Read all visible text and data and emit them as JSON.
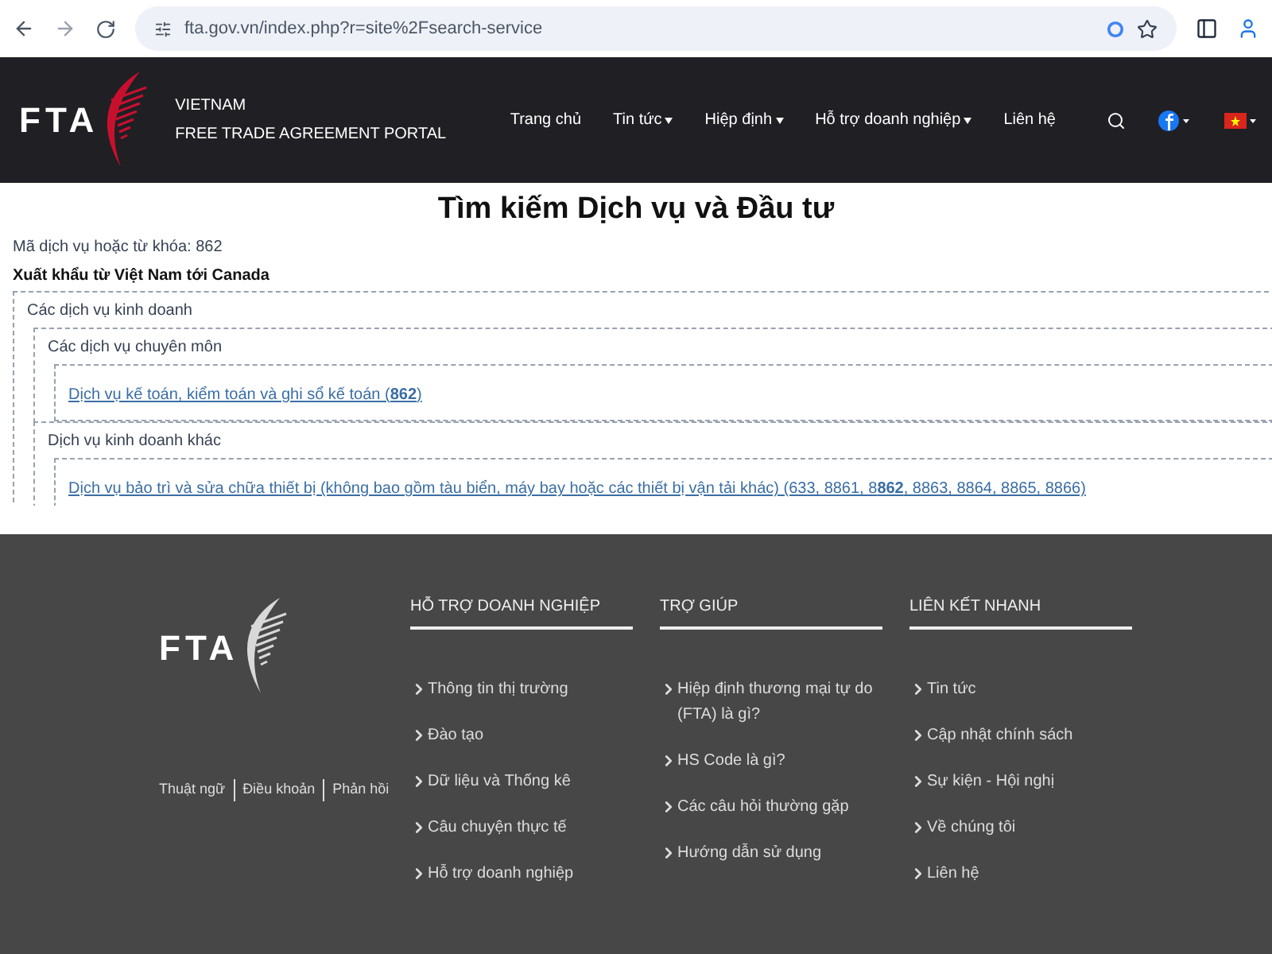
{
  "browser": {
    "url": "fta.gov.vn/index.php?r=site%2Fsearch-service"
  },
  "header": {
    "logo": "FTA",
    "site_line_1": "VIETNAM",
    "site_line_2": "FREE TRADE AGREEMENT PORTAL",
    "nav": [
      {
        "label": "Trang chủ",
        "dropdown": false
      },
      {
        "label": "Tin tức",
        "dropdown": true
      },
      {
        "label": "Hiệp định",
        "dropdown": true
      },
      {
        "label": "Hỗ trợ doanh nghiệp",
        "dropdown": true
      },
      {
        "label": "Liên hệ",
        "dropdown": false
      }
    ]
  },
  "page": {
    "title": "Tìm kiếm Dịch vụ và Đầu tư",
    "query": "Mã dịch vụ hoặc từ khóa: 862",
    "direction": "Xuất khẩu từ Việt Nam tới Canada",
    "tree": [
      {
        "title": "Các dịch vụ kinh doanh",
        "children": [
          {
            "title": "Các dịch vụ chuyên môn",
            "links": [
              "Dịch vụ kế toán, kiểm toán và ghi sổ kế toán (**862**)"
            ]
          },
          {
            "title": "Dịch vụ kinh doanh khác",
            "links": [
              "Dịch vụ bảo trì và sửa chữa thiết bị (không bao gồm tàu biển, máy bay hoặc các thiết bị vận tải khác) (633, 8861, 8**862**, 8863, 8864, 8865, 8866)"
            ]
          }
        ]
      }
    ]
  },
  "footer": {
    "logo": "FTA",
    "bottom_links": [
      "Thuật ngữ",
      "Điều khoản",
      "Phản hồi"
    ],
    "columns": [
      {
        "heading": "HỖ TRỢ DOANH NGHIỆP",
        "links": [
          "Thông tin thị trường",
          "Đào tạo",
          "Dữ liệu và Thống kê",
          "Câu chuyện thực tế",
          "Hỗ trợ doanh nghiệp"
        ]
      },
      {
        "heading": "TRỢ GIÚP",
        "links": [
          "Hiệp định thương mại tự do (FTA) là gì?",
          "HS Code là gì?",
          "Các câu hỏi thường gặp",
          "Hướng dẫn sử dụng"
        ]
      },
      {
        "heading": "LIÊN KẾT NHANH",
        "links": [
          "Tin tức",
          "Cập nhật chính sách",
          "Sự kiện - Hội nghị",
          "Về chúng tôi",
          "Liên hệ"
        ]
      }
    ]
  }
}
